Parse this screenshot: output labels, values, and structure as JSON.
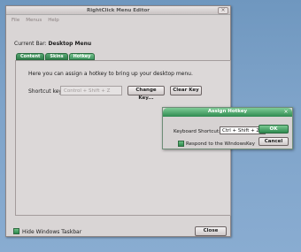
{
  "window": {
    "title": "RightClick Menu Editor",
    "close_glyph": "×",
    "menu": [
      "File",
      "Menus",
      "Help"
    ]
  },
  "current_bar": {
    "label": "Current Bar:",
    "value": "Desktop Menu"
  },
  "tabs": [
    {
      "label": "Content",
      "active": false
    },
    {
      "label": "Skins",
      "active": false
    },
    {
      "label": "Hotkey",
      "active": true
    }
  ],
  "hotkey_panel": {
    "description": "Here you can assign a hotkey to bring up your desktop menu.",
    "shortcut_label": "Shortcut key:",
    "shortcut_value": "Control + Shift + Z",
    "change_key_label": "Change Key...",
    "clear_key_label": "Clear Key"
  },
  "footer": {
    "hide_taskbar_label": "Hide Windows Taskbar",
    "hide_taskbar_checked": true,
    "close_label": "Close"
  },
  "assign_dialog": {
    "title": "Assign Hotkey",
    "close_glyph": "×",
    "keyboard_shortcut_label": "Keyboard Shortcut:",
    "keyboard_shortcut_value": "Ctrl + Shift + Z",
    "ok_label": "OK",
    "cancel_label": "Cancel",
    "respond_label": "Respond to the WindowsKey",
    "respond_checked": true
  },
  "colors": {
    "accent_green": "#2f8a50",
    "desktop_blue": "#7ea3c9",
    "window_bg": "#d9d5d5"
  }
}
